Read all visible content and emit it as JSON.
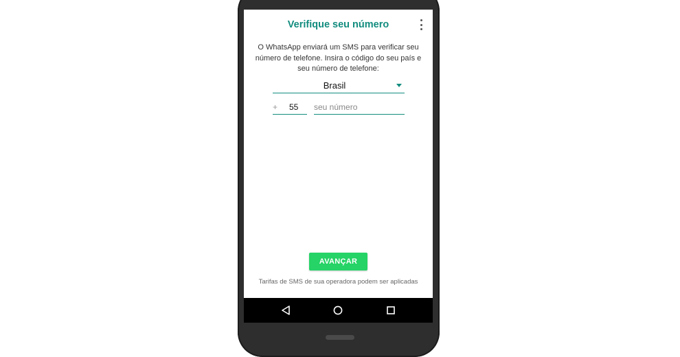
{
  "app": {
    "title": "Verifique seu número",
    "menu_icon": "more-vert-icon"
  },
  "instructions": {
    "text": "O WhatsApp enviará um SMS para verificar seu número de telefone. Insira o código do seu país e seu número de telefone:"
  },
  "country": {
    "selected": "Brasil",
    "icon": "dropdown-triangle-icon"
  },
  "phone": {
    "plus": "+",
    "country_code": "55",
    "number_value": "",
    "number_placeholder": "seu número"
  },
  "actions": {
    "next_label": "AVANÇAR"
  },
  "footer": {
    "sms_note": "Tarifas de SMS de sua operadora podem ser aplicadas"
  },
  "nav": {
    "back_icon": "back-triangle-icon",
    "home_icon": "home-circle-icon",
    "recent_icon": "recent-apps-square-icon"
  },
  "colors": {
    "accent": "#128c7e",
    "button": "#25d366",
    "nav_bar": "#000000",
    "phone_frame": "#2e2e2e"
  }
}
